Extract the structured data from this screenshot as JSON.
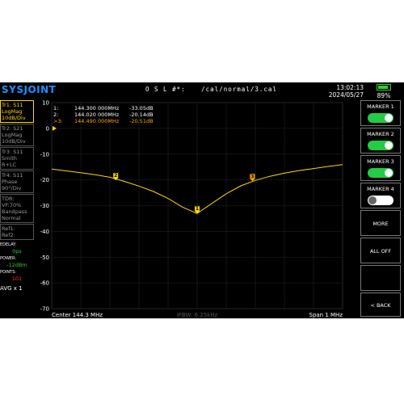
{
  "header": {
    "logo": "SYSJOINT",
    "cal_label": "O S L #*:",
    "cal_path": "/cal/normal/3.cal",
    "time": "13:02:13",
    "date": "2024/05/27",
    "battery_percent": "89%",
    "battery_level": 0.89
  },
  "traces": [
    {
      "line1": "Tr1:  S11",
      "line2": "LogMag",
      "line3": "10dB/Div",
      "active": true
    },
    {
      "line1": "Tr2:  S21",
      "line2": "LogMag",
      "line3": "10dB/Div",
      "active": false
    },
    {
      "line1": "Tr3:  S11",
      "line2": "Smith",
      "line3": "R+LC",
      "active": false
    },
    {
      "line1": "Tr4:  S11",
      "line2": "Phase",
      "line3": "90°/Div",
      "active": false
    }
  ],
  "tdr": {
    "line1": "TDR:",
    "line2": "VF:70%",
    "line3": "Bandpass",
    "line4": "Normal"
  },
  "refs": {
    "ref1": "Ref1:",
    "ref2": "Ref2:"
  },
  "status": {
    "edelay_label": "EDELAY:",
    "edelay_value": "0ps",
    "power_label": "POWER:",
    "power_value": "-12dBm",
    "points_label": "POINTS:",
    "points_value": "101",
    "avg": "AVG x 1"
  },
  "plot": {
    "center_label": "Center   144.3 MHz",
    "ifbw_label": "IFBW: 6.25kHz",
    "span_label": "Span   1 MHz"
  },
  "markers": [
    {
      "prefix": "1:",
      "freq": "144.300 000MHz",
      "value": "-33.05dB"
    },
    {
      "prefix": "2:",
      "freq": "144.020 000MHz",
      "value": "-20.14dB"
    },
    {
      "prefix": ">3:",
      "freq": "144.490 000MHz",
      "value": "-20.51dB"
    }
  ],
  "buttons": [
    {
      "label": "MARKER 1",
      "toggle": true
    },
    {
      "label": "MARKER 2",
      "toggle": true
    },
    {
      "label": "MARKER 3",
      "toggle": true
    },
    {
      "label": "MARKER 4",
      "toggle": false
    },
    {
      "label": "MORE"
    },
    {
      "label": "ALL OFF"
    },
    {
      "label": ""
    },
    {
      "label": "< BACK"
    }
  ],
  "colors": {
    "trace": "#ffd700",
    "marker_active": "#ffa500",
    "toggle_on": "#22cc44",
    "toggle_off": "#ffffff",
    "logo": "#1e90ff",
    "grid": "#444444"
  },
  "chart_data": {
    "type": "line",
    "series": [
      {
        "x": [
          143.8,
          143.85,
          143.9,
          143.95,
          144.0,
          144.05,
          144.1,
          144.15,
          144.2,
          144.25,
          144.3,
          144.35,
          144.4,
          144.45,
          144.5,
          144.55,
          144.6,
          144.65,
          144.7,
          144.75,
          144.8
        ],
        "values": [
          -15.8,
          -16.5,
          -17.2,
          -18.0,
          -19.0,
          -20.6,
          -22.4,
          -24.5,
          -27.2,
          -30.6,
          -33.05,
          -29.2,
          -25.4,
          -22.3,
          -20.2,
          -18.6,
          -17.4,
          -16.4,
          -15.6,
          -14.8,
          -14.1
        ]
      }
    ],
    "markers": [
      {
        "label": "1",
        "x": 144.3,
        "y": -33.05
      },
      {
        "label": "2",
        "x": 144.02,
        "y": -20.14
      },
      {
        "label": "3",
        "x": 144.49,
        "y": -20.51
      }
    ],
    "ylim": [
      -70,
      10
    ],
    "xlim": [
      143.8,
      144.8
    ],
    "yticks": [
      "10",
      "0",
      "-10",
      "-20",
      "-30",
      "-40",
      "-50",
      "-60",
      "-70"
    ],
    "grid": true
  }
}
